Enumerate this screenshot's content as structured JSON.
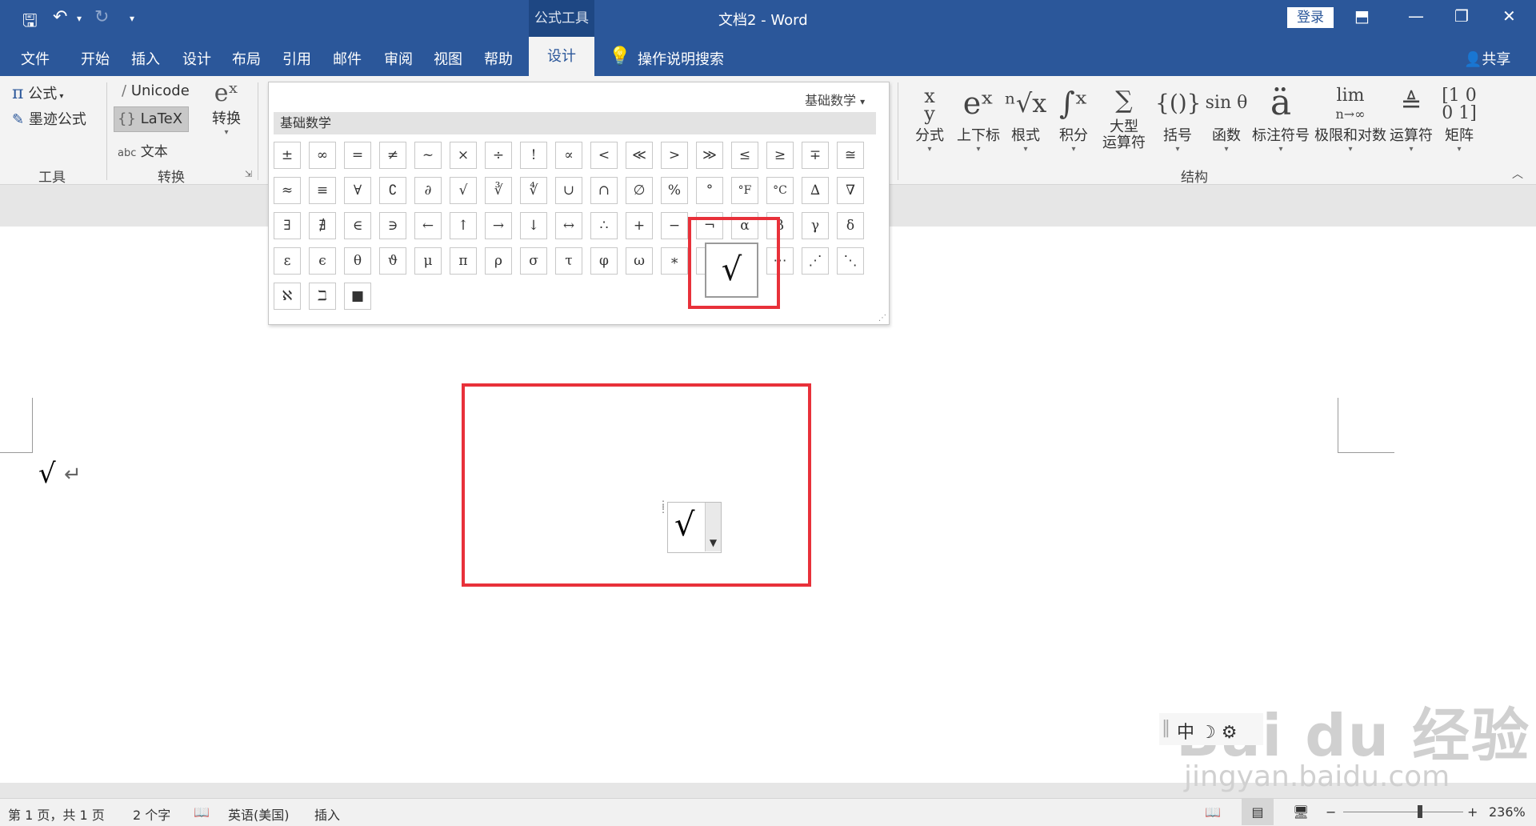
{
  "titlebar": {
    "contextual_group": "公式工具",
    "doc_title": "文档2  -  Word",
    "login": "登录",
    "quick_access": {
      "save": "save-icon",
      "undo": "undo-icon",
      "redo": "redo-icon",
      "customize": "customize-icon"
    }
  },
  "tabs": [
    "文件",
    "开始",
    "插入",
    "设计",
    "布局",
    "引用",
    "邮件",
    "审阅",
    "视图",
    "帮助"
  ],
  "active_tab": "设计",
  "tell_me": "操作说明搜索",
  "share": "共享",
  "ribbon": {
    "tools": {
      "equation": "公式",
      "ink_equation": "墨迹公式",
      "group_label": "工具"
    },
    "conversion": {
      "unicode": "Unicode",
      "latex": "LaTeX",
      "text": "文本",
      "convert": "转换",
      "group_label": "转换"
    },
    "structures": {
      "group_label": "结构",
      "items": [
        {
          "glyph": "x/y",
          "label": "分式"
        },
        {
          "glyph": "eˣ",
          "label": "上下标"
        },
        {
          "glyph": "ⁿ√x",
          "label": "根式"
        },
        {
          "glyph": "∫",
          "label": "积分"
        },
        {
          "glyph": "∑",
          "label": "大型\n运算符"
        },
        {
          "glyph": "{()}",
          "label": "括号"
        },
        {
          "glyph": "sin θ",
          "label": "函数"
        },
        {
          "glyph": "ä",
          "label": "标注符号"
        },
        {
          "glyph": "lim",
          "label": "极限和对数"
        },
        {
          "glyph": "Δ",
          "label": "运算符"
        },
        {
          "glyph": "[10]",
          "label": "矩阵"
        }
      ]
    }
  },
  "gallery": {
    "category_dropdown": "基础数学",
    "header": "基础数学",
    "symbols": [
      [
        "±",
        "∞",
        "=",
        "≠",
        "~",
        "×",
        "÷",
        "!",
        "∝",
        "<",
        "≪",
        ">",
        "≫",
        "≤",
        "≥",
        "∓",
        "≅"
      ],
      [
        "≈",
        "≡",
        "∀",
        "∁",
        "∂",
        "√",
        "∛",
        "∜",
        "∪",
        "∩",
        "∅",
        "%",
        "°",
        "°F",
        "°C",
        "∆",
        "∇"
      ],
      [
        "∃",
        "∄",
        "∈",
        "∋",
        "←",
        "↑",
        "→",
        "↓",
        "↔",
        "∴",
        "+",
        "−",
        "¬",
        "α",
        "β",
        "γ",
        "δ"
      ],
      [
        "ε",
        "ϵ",
        "θ",
        "ϑ",
        "μ",
        "π",
        "ρ",
        "σ",
        "τ",
        "φ",
        "ω",
        "∗",
        "·",
        "⋮",
        "⋯",
        "⋰",
        "⋱"
      ],
      [
        "ℵ",
        "ℶ",
        "■"
      ]
    ],
    "tooltip_symbol": "√"
  },
  "document": {
    "line1_symbol": "√",
    "paragraph_mark": "↵",
    "equation_symbol": "√"
  },
  "ime": {
    "text": "中 ☽ ⚙"
  },
  "watermark": {
    "main": "Bai du 经验",
    "sub": "jingyan.baidu.com"
  },
  "status": {
    "page": "第 1 页，共 1 页",
    "words": "2 个字",
    "language": "英语(美国)",
    "mode": "插入",
    "zoom": "236%",
    "zoom_minus": "−",
    "zoom_plus": "+"
  },
  "colors": {
    "brand": "#2b579a",
    "highlight": "#e8313a"
  }
}
